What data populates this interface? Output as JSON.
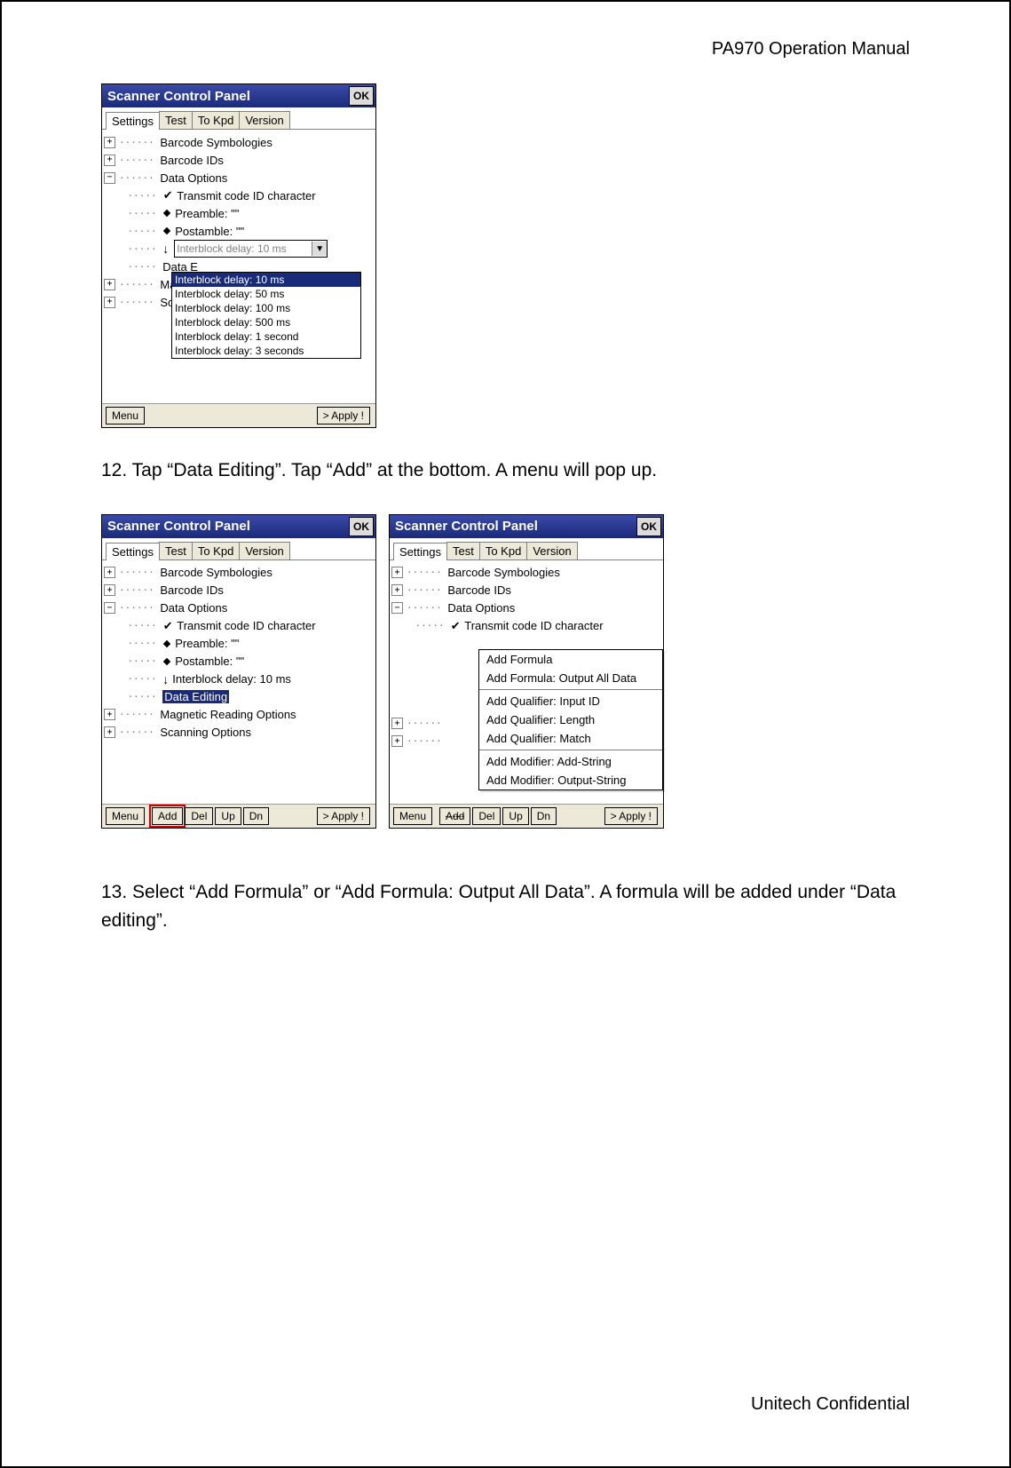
{
  "doc": {
    "header": "PA970 Operation Manual",
    "footer": "Unitech Confidential",
    "step12": "12. Tap “Data Editing”. Tap “Add” at the bottom. A menu will pop up.",
    "step13": "13. Select “Add Formula” or “Add Formula: Output All Data”. A formula will be added under “Data editing”."
  },
  "common": {
    "title": "Scanner Control Panel",
    "ok": "OK",
    "tabs": {
      "settings": "Settings",
      "test": "Test",
      "tokpd": "To Kpd",
      "version": "Version"
    },
    "buttons": {
      "menu": "Menu",
      "apply": "> Apply !",
      "add": "Add",
      "del": "Del",
      "up": "Up",
      "dn": "Dn"
    }
  },
  "panel1": {
    "tree": {
      "n0": "Barcode Symbologies",
      "n1": "Barcode IDs",
      "n2": "Data Options",
      "n2c0": "Transmit code ID character",
      "n2c1": "Preamble: \"\"",
      "n2c2": "Postamble: \"\"",
      "n2c3_field": "Interblock delay: 10 ms",
      "n2c4": "Data Editing",
      "n3": "Magnetic Reading Options",
      "n4": "Scanning Options"
    },
    "dropdown": {
      "opt0": "Interblock delay: 10 ms",
      "opt1": "Interblock delay: 50 ms",
      "opt2": "Interblock delay: 100 ms",
      "opt3": "Interblock delay: 500 ms",
      "opt4": "Interblock delay: 1 second",
      "opt5": "Interblock delay: 3 seconds"
    }
  },
  "panel2": {
    "tree": {
      "n0": "Barcode Symbologies",
      "n1": "Barcode IDs",
      "n2": "Data Options",
      "n2c0": "Transmit code ID character",
      "n2c1": "Preamble: \"\"",
      "n2c2": "Postamble: \"\"",
      "n2c3": "Interblock delay: 10 ms",
      "n2c4": "Data Editing",
      "n3": "Magnetic Reading Options",
      "n4": "Scanning Options"
    }
  },
  "panel3": {
    "tree": {
      "n0": "Barcode Symbologies",
      "n1": "Barcode IDs",
      "n2": "Data Options",
      "n2c0": "Transmit code ID character"
    },
    "menu": {
      "m0": "Add Formula",
      "m1": "Add Formula: Output All Data",
      "m2": "Add Qualifier: Input ID",
      "m3": "Add Qualifier: Length",
      "m4": "Add Qualifier: Match",
      "m5": "Add Modifier: Add-String",
      "m6": "Add Modifier: Output-String"
    }
  }
}
